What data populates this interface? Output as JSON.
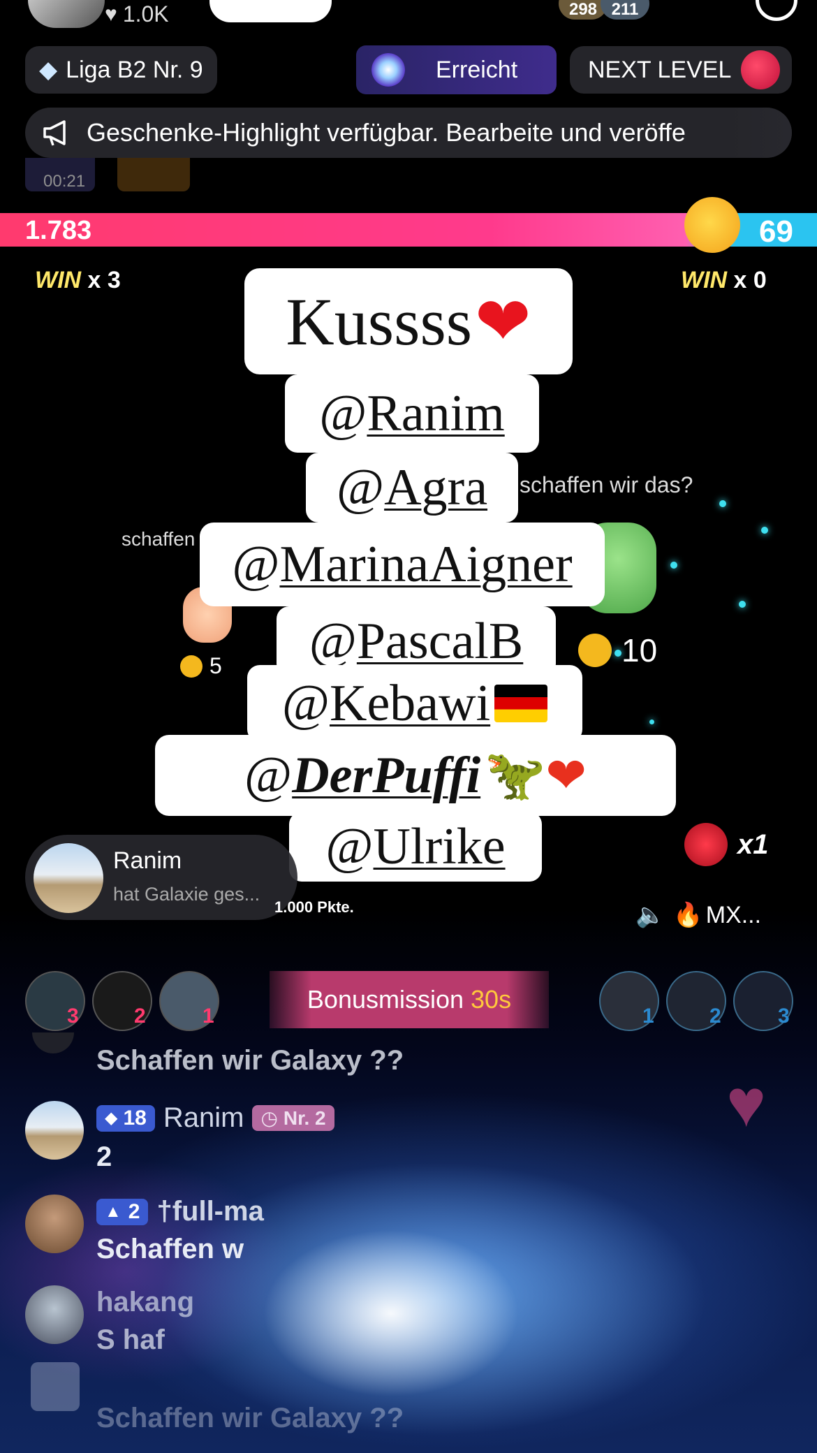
{
  "header": {
    "likes": "1.0K",
    "viewer_counts": [
      "298",
      "211"
    ],
    "league": "Liga B2 Nr. 9",
    "reached_label": "Erreicht",
    "next_level_label": "NEXT LEVEL"
  },
  "banner": {
    "text": "Geschenke-Highlight verfügbar. Bearbeite und veröffe"
  },
  "pip": {
    "time": "00:21"
  },
  "battle": {
    "left_score": "1.783",
    "right_score": "69",
    "left_win_label": "WIN",
    "left_win_count": "x 3",
    "right_win_label": "WIN",
    "right_win_count": "x 0",
    "left_caption": "schaffen",
    "right_caption": "schaffen wir das?",
    "left_coins": "5",
    "right_coins": "10"
  },
  "sticker": {
    "title": "Kussss",
    "mentions": [
      "Ranim",
      "Agra",
      "MarinaAigner",
      "PascalB",
      "Kebawi",
      "DerPuffi",
      "Ulrike"
    ]
  },
  "gift_toast": {
    "name": "Ranim",
    "action": "hat Galaxie  ges...",
    "points": "1.000 Pkte."
  },
  "rose": {
    "count": "x1"
  },
  "music": {
    "label": "MX..."
  },
  "bonus": {
    "label": "Bonusmission",
    "time": "30s",
    "left_ranks": [
      "3",
      "2",
      "1"
    ],
    "right_ranks": [
      "1",
      "2",
      "3"
    ]
  },
  "chat": [
    {
      "name": "",
      "text": "Schaffen wir Galaxy ??",
      "badge_level": "",
      "rank_badge": ""
    },
    {
      "name": "Ranim",
      "text": "2",
      "badge_level": "18",
      "rank_badge": "Nr. 2"
    },
    {
      "name": "†full-ma",
      "text": "Schaffen w",
      "badge_level": "2",
      "rank_badge": ""
    },
    {
      "name": "hakang",
      "text": "S  haf",
      "badge_level": "",
      "rank_badge": ""
    },
    {
      "name": "",
      "text": "Schaffen wir Galaxy ??",
      "badge_level": "",
      "rank_badge": ""
    }
  ],
  "colors": {
    "left_bar": "#ff2d6f",
    "right_bar": "#2bc4f0",
    "win_text": "#ffe86a",
    "bonus_time": "#ffc93c",
    "erreicht_bg": "#3a2a7a"
  },
  "icons": [
    "heart-icon",
    "diamond-icon",
    "megaphone-icon",
    "rose-icon",
    "speaker-icon",
    "fire-icon",
    "like-heart-icon"
  ]
}
